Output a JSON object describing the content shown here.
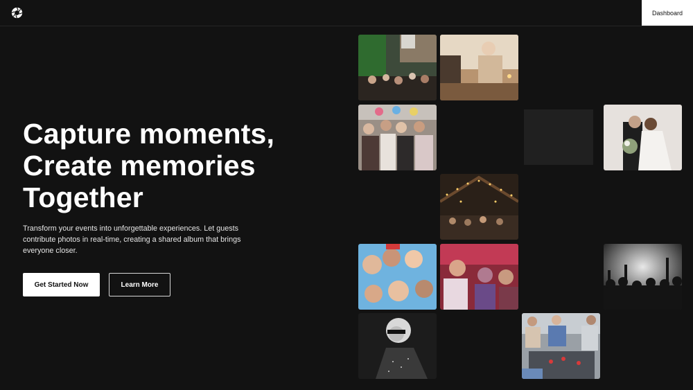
{
  "header": {
    "logo_icon": "aperture-icon",
    "dashboard_label": "Dashboard"
  },
  "hero": {
    "title_lines": [
      "Capture moments,",
      "Create memories",
      "Together"
    ],
    "subtitle": "Transform your events into unforgettable experiences. Let guests contribute photos in real-time, creating a shared album that brings everyone closer.",
    "primary_cta": "Get Started Now",
    "secondary_cta": "Learn More"
  },
  "gallery": [
    {
      "id": "street-party-photo"
    },
    {
      "id": "dinner-toast-photo"
    },
    {
      "id": "birthday-group-photo"
    },
    {
      "id": "wedding-kiss-photo"
    },
    {
      "id": "string-lights-party-photo"
    },
    {
      "id": "friends-circle-photo"
    },
    {
      "id": "selfie-friends-photo"
    },
    {
      "id": "concert-crowd-photo"
    },
    {
      "id": "woman-sunglasses-photo"
    },
    {
      "id": "picnic-friends-photo"
    }
  ],
  "colors": {
    "background": "#121212",
    "button_bg": "#ffffff",
    "text": "#ffffff"
  }
}
